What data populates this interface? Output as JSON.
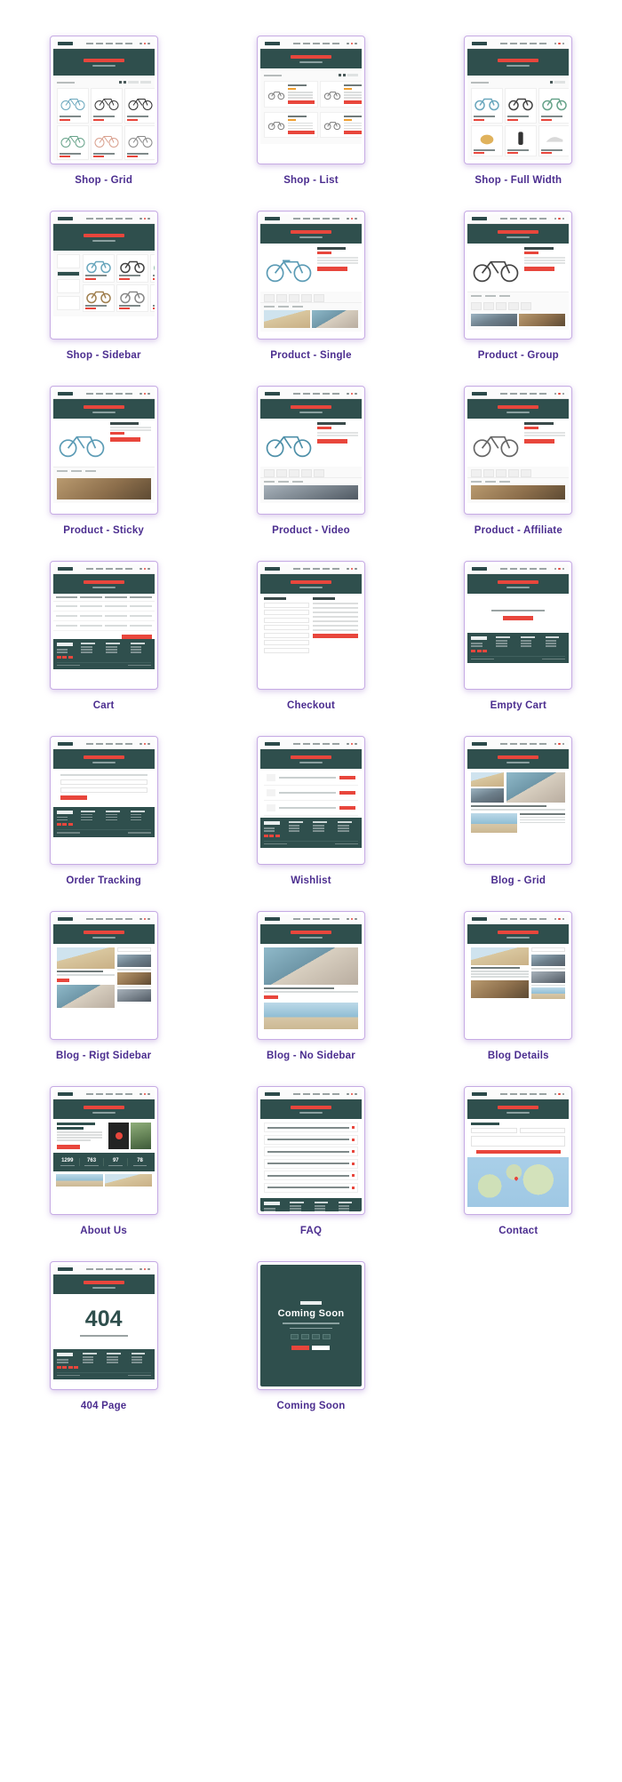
{
  "theme": {
    "accent_red": "#e8463c",
    "dark_teal": "#2f4f4d",
    "caption_purple": "#4b2d8f",
    "frame_border": "#c6abe4",
    "page_background": "#ffffff"
  },
  "showcase": {
    "columns": 3,
    "total_items": 23,
    "items": [
      {
        "id": "shop-grid",
        "label": "Shop - Grid",
        "kind": "shop-grid"
      },
      {
        "id": "shop-list",
        "label": "Shop - List",
        "kind": "shop-list"
      },
      {
        "id": "shop-full-width",
        "label": "Shop - Full Width",
        "kind": "shop-full"
      },
      {
        "id": "shop-sidebar",
        "label": "Shop - Sidebar",
        "kind": "shop-sidebar"
      },
      {
        "id": "product-single",
        "label": "Product - Single",
        "kind": "product-single"
      },
      {
        "id": "product-group",
        "label": "Product - Group",
        "kind": "product-group"
      },
      {
        "id": "product-sticky",
        "label": "Product - Sticky",
        "kind": "product-sticky"
      },
      {
        "id": "product-video",
        "label": "Product - Video",
        "kind": "product-video"
      },
      {
        "id": "product-affiliate",
        "label": "Product - Affiliate",
        "kind": "product-affiliate"
      },
      {
        "id": "cart",
        "label": "Cart",
        "kind": "cart"
      },
      {
        "id": "checkout",
        "label": "Checkout",
        "kind": "checkout"
      },
      {
        "id": "empty-cart",
        "label": "Empty Cart",
        "kind": "empty-cart"
      },
      {
        "id": "order-tracking",
        "label": "Order Tracking",
        "kind": "order-tracking"
      },
      {
        "id": "wishlist",
        "label": "Wishlist",
        "kind": "wishlist"
      },
      {
        "id": "blog-grid",
        "label": "Blog - Grid",
        "kind": "blog-grid"
      },
      {
        "id": "blog-right-sidebar",
        "label": "Blog - Rigt Sidebar",
        "kind": "blog-sidebar"
      },
      {
        "id": "blog-no-sidebar",
        "label": "Blog - No Sidebar",
        "kind": "blog-nosidebar"
      },
      {
        "id": "blog-details",
        "label": "Blog Details",
        "kind": "blog-details"
      },
      {
        "id": "about-us",
        "label": "About Us",
        "kind": "about"
      },
      {
        "id": "faq",
        "label": "FAQ",
        "kind": "faq"
      },
      {
        "id": "contact",
        "label": "Contact",
        "kind": "contact"
      },
      {
        "id": "404-page",
        "label": "404 Page",
        "kind": "notfound"
      },
      {
        "id": "coming-soon",
        "label": "Coming Soon",
        "kind": "coming-soon"
      }
    ]
  },
  "thumbnail_text": {
    "not_found_code": "404",
    "coming_soon_title": "Coming Soon",
    "about_stats": [
      "1299",
      "763",
      "97",
      "78"
    ]
  }
}
